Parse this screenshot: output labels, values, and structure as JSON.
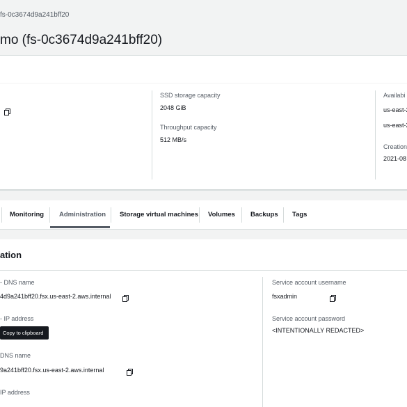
{
  "breadcrumb": {
    "text": "fs-0c3674d9a241bff20"
  },
  "page": {
    "title": "mo (fs-0c3674d9a241bff20)"
  },
  "summary": {
    "ssd_label": "SSD storage capacity",
    "ssd_value": "2048 GiB",
    "throughput_label": "Throughput capacity",
    "throughput_value": "512 MB/s",
    "avail_label": "Availabi",
    "avail_value1": "us-east-2",
    "avail_value2": "us-east-2",
    "creation_label": "Creation",
    "creation_value": "2021-08"
  },
  "tabs": [
    {
      "label": "Monitoring"
    },
    {
      "label": "Administration"
    },
    {
      "label": "Storage virtual machines"
    },
    {
      "label": "Volumes"
    },
    {
      "label": "Backups"
    },
    {
      "label": "Tags"
    }
  ],
  "admin": {
    "section_title": "ation",
    "dns1_label": "- DNS name",
    "dns1_value": "4d9a241bff20.fsx.us-east-2.aws.internal",
    "ip1_label": "- IP address",
    "tooltip": "Copy to clipboard",
    "dns2_label": "DNS name",
    "dns2_value": "9a241bff20.fsx.us-east-2.aws.internal",
    "ip2_label": "IP address",
    "svc_user_label": "Service account username",
    "svc_user_value": "fsxadmin",
    "svc_pass_label": "Service account password",
    "svc_pass_value": "<INTENTIONALLY REDACTED>"
  },
  "colors": {
    "background": "#f2f3f3",
    "panel": "#ffffff",
    "text": "#16191f",
    "muted": "#545b64",
    "tooltip": "#16191f"
  }
}
